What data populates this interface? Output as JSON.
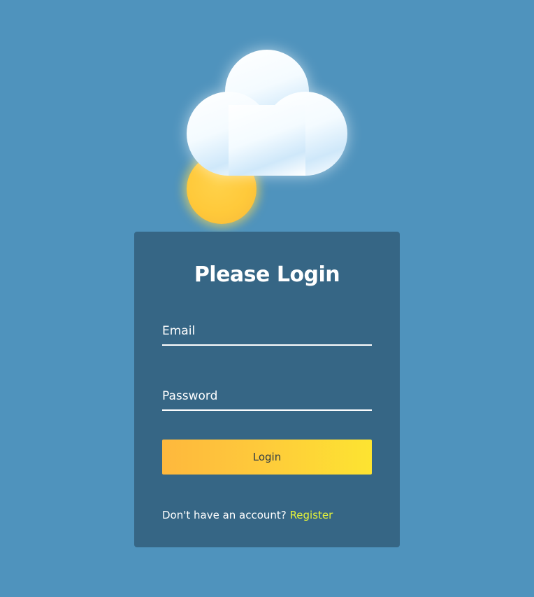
{
  "illustration": {
    "cloud_icon": "cloud-icon",
    "sun_icon": "sun-icon",
    "cloud_color": "#ffffff",
    "sun_color": "#ffc93a"
  },
  "login": {
    "title": "Please Login",
    "email_placeholder": "Email",
    "password_placeholder": "Password",
    "login_button_label": "Login",
    "register_prompt": "Don't have an account?",
    "register_link_label": "Register"
  },
  "colors": {
    "page_background": "#4f93bd",
    "card_background": "#366685",
    "button_gradient_start": "#feb83d",
    "button_gradient_end": "#fde431",
    "link_color": "#e4f23a"
  }
}
